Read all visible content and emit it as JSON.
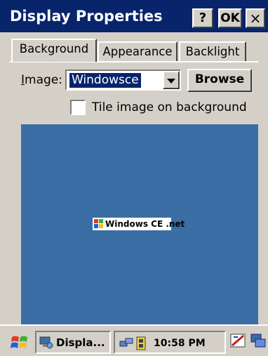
{
  "window": {
    "title": "Display Properties",
    "help_label": "?",
    "ok_label": "OK",
    "close_label": "×"
  },
  "tabs": [
    {
      "label": "Background",
      "selected": true
    },
    {
      "label": "Appearance",
      "selected": false
    },
    {
      "label": "Backlight",
      "selected": false
    }
  ],
  "background": {
    "image_label": "Image:",
    "image_value": "Windowsce",
    "browse_label": "Browse",
    "tile_label": "Tile image on background",
    "tile_checked": false,
    "preview_text": "Windows CE .net",
    "preview_color": "#3a6ea5"
  },
  "taskbar": {
    "task_label": "Displa...",
    "clock": "10:58 PM",
    "icons": [
      "start-flag-icon",
      "display-icon",
      "network-icon",
      "battery-icon",
      "input-panel-icon",
      "desktop-icon"
    ]
  },
  "colors": {
    "titlebar": "#08246b",
    "selection": "#08246b",
    "face": "#d4d0c8"
  }
}
